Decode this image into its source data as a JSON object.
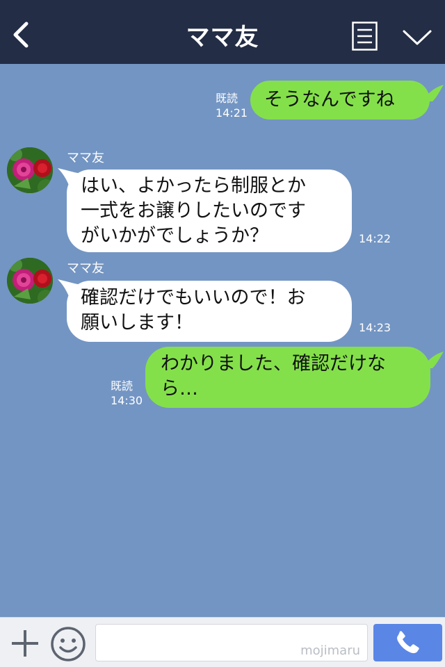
{
  "header": {
    "title": "ママ友"
  },
  "messages": [
    {
      "side": "me",
      "text": "そうなんですね",
      "read": "既読",
      "time": "14:21"
    },
    {
      "side": "them",
      "sender": "ママ友",
      "lines": [
        "はい、よかったら制服とか",
        "一式をお譲りしたいのです",
        "がいかがでしょうか？"
      ],
      "time": "14:22"
    },
    {
      "side": "them",
      "sender": "ママ友",
      "lines": [
        "確認だけでもいいので！お",
        "願いします！"
      ],
      "time": "14:23"
    },
    {
      "side": "me",
      "lines": [
        "わかりました、確認だけな",
        "ら…"
      ],
      "read": "既読",
      "time": "14:30"
    }
  ],
  "footer": {
    "input_value": "",
    "watermark": "mojimaru"
  },
  "icons": {
    "back": "chevron-left-icon",
    "menu": "menu-icon",
    "collapse": "chevron-down-icon",
    "add": "plus-icon",
    "emoji": "smile-icon",
    "call": "phone-icon"
  },
  "colors": {
    "header_bg": "#232d45",
    "chat_bg": "#7395c3",
    "my_bubble": "#84e04a",
    "their_bubble": "#ffffff",
    "call_button": "#5a86e6"
  }
}
